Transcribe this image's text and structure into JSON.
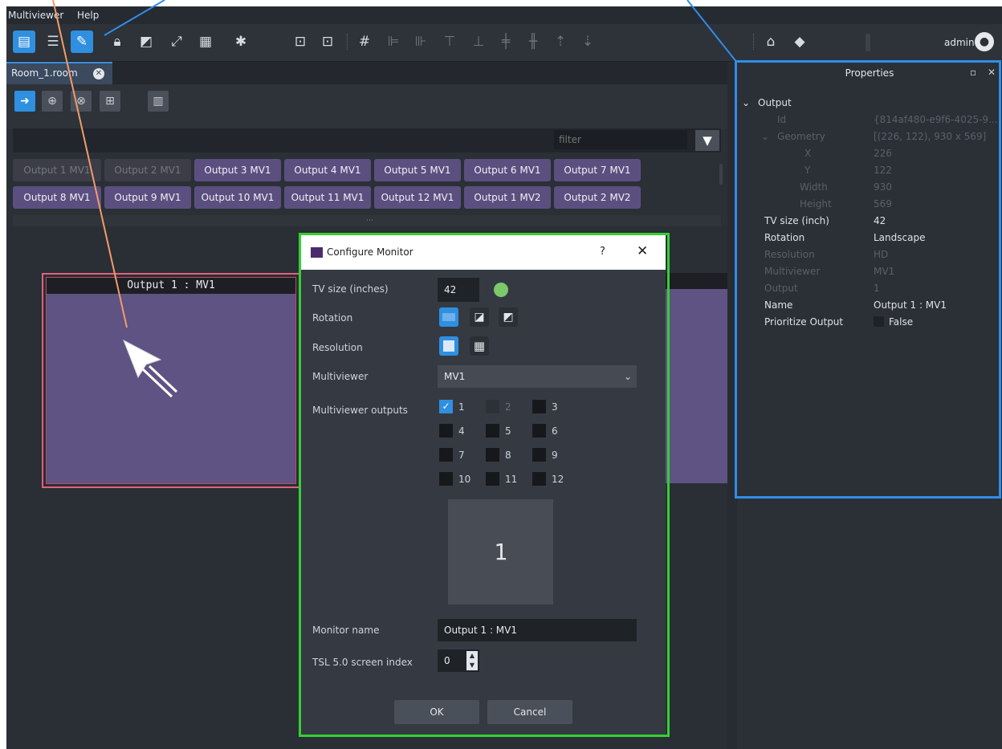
{
  "menubar": {
    "items": [
      "Multiviewer",
      "Help"
    ]
  },
  "toolbar": {
    "buttons": [
      "monitor-info-icon",
      "tree-icon",
      "edit-icon",
      "lock-icon",
      "layers-icon",
      "fullscreen-icon",
      "grid-icon",
      "gear-icon",
      "export-icon",
      "import-icon",
      "grid-lines-icon",
      "align-left-icon",
      "align-right-icon",
      "align-top-icon",
      "align-bottom-icon",
      "center-v-icon",
      "center-h-icon",
      "distribute-top-icon",
      "distribute-bottom-icon",
      "home-icon",
      "tag-icon"
    ],
    "user_label": "admin"
  },
  "tab": {
    "label": "Room_1.room"
  },
  "filter": {
    "placeholder": "filter"
  },
  "outputs": {
    "row1": [
      "Output 1 MV1",
      "Output 2 MV1",
      "Output 3 MV1",
      "Output 4 MV1",
      "Output 5 MV1",
      "Output 6 MV1",
      "Output 7 MV1"
    ],
    "row2": [
      "Output 8 MV1",
      "Output 9 MV1",
      "Output 10 MV1",
      "Output 11 MV1",
      "Output 12 MV1",
      "Output 1 MV2",
      "Output 2 MV2"
    ]
  },
  "canvas": {
    "monitor_title": "Output 1 : MV1"
  },
  "properties": {
    "title": "Properties",
    "section": "Output",
    "rows": {
      "id": {
        "key": "Id",
        "value": "{814af480-e9f6-4025-9..."
      },
      "geometry": {
        "key": "Geometry",
        "value": "[(226, 122), 930 x 569]"
      },
      "x": {
        "key": "X",
        "value": "226"
      },
      "y": {
        "key": "Y",
        "value": "122"
      },
      "width": {
        "key": "Width",
        "value": "930"
      },
      "height": {
        "key": "Height",
        "value": "569"
      },
      "tv_size": {
        "key": "TV size (inch)",
        "value": "42"
      },
      "rotation": {
        "key": "Rotation",
        "value": "Landscape"
      },
      "resolution": {
        "key": "Resolution",
        "value": "HD"
      },
      "multiviewer": {
        "key": "Multiviewer",
        "value": "MV1"
      },
      "output": {
        "key": "Output",
        "value": "1"
      },
      "name": {
        "key": "Name",
        "value": "Output 1 : MV1"
      },
      "prioritize": {
        "key": "Prioritize Output",
        "value": "False"
      }
    }
  },
  "dialog": {
    "title": "Configure Monitor",
    "help": "?",
    "close": "✕",
    "tv_size_label": "TV size (inches)",
    "tv_size_value": "42",
    "rotation_label": "Rotation",
    "resolution_label": "Resolution",
    "multiviewer_label": "Multiviewer",
    "multiviewer_value": "MV1",
    "outputs_label": "Multiviewer outputs",
    "outputs": [
      "1",
      "2",
      "3",
      "4",
      "5",
      "6",
      "7",
      "8",
      "9",
      "10",
      "11",
      "12"
    ],
    "preview_text": "1",
    "monitor_name_label": "Monitor name",
    "monitor_name_value": "Output 1 : MV1",
    "tsl_label": "TSL 5.0 screen index",
    "tsl_value": "0",
    "ok": "OK",
    "cancel": "Cancel"
  },
  "colors": {
    "accent": "#2f8fe0",
    "output_button": "#5b4f7f",
    "annotation_green": "#33d033",
    "annotation_blue": "#2f8de8",
    "annotation_orange": "#f29b6b",
    "monitor_border": "#e0627c"
  }
}
